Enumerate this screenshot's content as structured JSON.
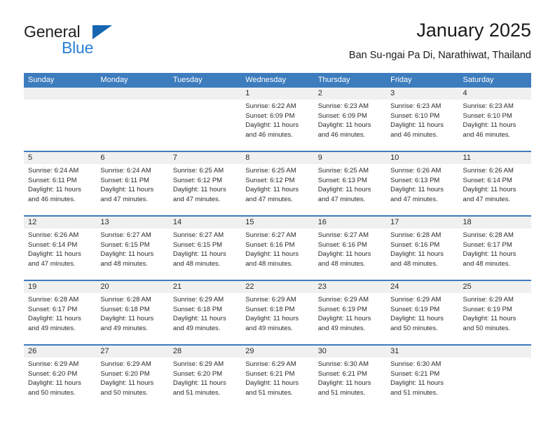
{
  "logo": {
    "word_top": "General",
    "word_bottom": "Blue",
    "triangle_icon": "triangle-icon",
    "color_text": "#231f20",
    "color_blue": "#2980d4",
    "color_triangle": "#1666b0"
  },
  "header": {
    "title": "January 2025",
    "subtitle": "Ban Su-ngai Pa Di, Narathiwat, Thailand"
  },
  "theme": {
    "header_blue": "#3d7cbd",
    "row_band_gray": "#f0f0f0",
    "text": "#2b2b2b"
  },
  "calendar": {
    "weekday_headers": [
      "Sunday",
      "Monday",
      "Tuesday",
      "Wednesday",
      "Thursday",
      "Friday",
      "Saturday"
    ],
    "weeks": [
      [
        {
          "day": "",
          "sunrise": "",
          "sunset": "",
          "daylight_line1": "",
          "daylight_line2": ""
        },
        {
          "day": "",
          "sunrise": "",
          "sunset": "",
          "daylight_line1": "",
          "daylight_line2": ""
        },
        {
          "day": "",
          "sunrise": "",
          "sunset": "",
          "daylight_line1": "",
          "daylight_line2": ""
        },
        {
          "day": "1",
          "sunrise": "Sunrise: 6:22 AM",
          "sunset": "Sunset: 6:09 PM",
          "daylight_line1": "Daylight: 11 hours",
          "daylight_line2": "and 46 minutes."
        },
        {
          "day": "2",
          "sunrise": "Sunrise: 6:23 AM",
          "sunset": "Sunset: 6:09 PM",
          "daylight_line1": "Daylight: 11 hours",
          "daylight_line2": "and 46 minutes."
        },
        {
          "day": "3",
          "sunrise": "Sunrise: 6:23 AM",
          "sunset": "Sunset: 6:10 PM",
          "daylight_line1": "Daylight: 11 hours",
          "daylight_line2": "and 46 minutes."
        },
        {
          "day": "4",
          "sunrise": "Sunrise: 6:23 AM",
          "sunset": "Sunset: 6:10 PM",
          "daylight_line1": "Daylight: 11 hours",
          "daylight_line2": "and 46 minutes."
        }
      ],
      [
        {
          "day": "5",
          "sunrise": "Sunrise: 6:24 AM",
          "sunset": "Sunset: 6:11 PM",
          "daylight_line1": "Daylight: 11 hours",
          "daylight_line2": "and 46 minutes."
        },
        {
          "day": "6",
          "sunrise": "Sunrise: 6:24 AM",
          "sunset": "Sunset: 6:11 PM",
          "daylight_line1": "Daylight: 11 hours",
          "daylight_line2": "and 47 minutes."
        },
        {
          "day": "7",
          "sunrise": "Sunrise: 6:25 AM",
          "sunset": "Sunset: 6:12 PM",
          "daylight_line1": "Daylight: 11 hours",
          "daylight_line2": "and 47 minutes."
        },
        {
          "day": "8",
          "sunrise": "Sunrise: 6:25 AM",
          "sunset": "Sunset: 6:12 PM",
          "daylight_line1": "Daylight: 11 hours",
          "daylight_line2": "and 47 minutes."
        },
        {
          "day": "9",
          "sunrise": "Sunrise: 6:25 AM",
          "sunset": "Sunset: 6:13 PM",
          "daylight_line1": "Daylight: 11 hours",
          "daylight_line2": "and 47 minutes."
        },
        {
          "day": "10",
          "sunrise": "Sunrise: 6:26 AM",
          "sunset": "Sunset: 6:13 PM",
          "daylight_line1": "Daylight: 11 hours",
          "daylight_line2": "and 47 minutes."
        },
        {
          "day": "11",
          "sunrise": "Sunrise: 6:26 AM",
          "sunset": "Sunset: 6:14 PM",
          "daylight_line1": "Daylight: 11 hours",
          "daylight_line2": "and 47 minutes."
        }
      ],
      [
        {
          "day": "12",
          "sunrise": "Sunrise: 6:26 AM",
          "sunset": "Sunset: 6:14 PM",
          "daylight_line1": "Daylight: 11 hours",
          "daylight_line2": "and 47 minutes."
        },
        {
          "day": "13",
          "sunrise": "Sunrise: 6:27 AM",
          "sunset": "Sunset: 6:15 PM",
          "daylight_line1": "Daylight: 11 hours",
          "daylight_line2": "and 48 minutes."
        },
        {
          "day": "14",
          "sunrise": "Sunrise: 6:27 AM",
          "sunset": "Sunset: 6:15 PM",
          "daylight_line1": "Daylight: 11 hours",
          "daylight_line2": "and 48 minutes."
        },
        {
          "day": "15",
          "sunrise": "Sunrise: 6:27 AM",
          "sunset": "Sunset: 6:16 PM",
          "daylight_line1": "Daylight: 11 hours",
          "daylight_line2": "and 48 minutes."
        },
        {
          "day": "16",
          "sunrise": "Sunrise: 6:27 AM",
          "sunset": "Sunset: 6:16 PM",
          "daylight_line1": "Daylight: 11 hours",
          "daylight_line2": "and 48 minutes."
        },
        {
          "day": "17",
          "sunrise": "Sunrise: 6:28 AM",
          "sunset": "Sunset: 6:16 PM",
          "daylight_line1": "Daylight: 11 hours",
          "daylight_line2": "and 48 minutes."
        },
        {
          "day": "18",
          "sunrise": "Sunrise: 6:28 AM",
          "sunset": "Sunset: 6:17 PM",
          "daylight_line1": "Daylight: 11 hours",
          "daylight_line2": "and 48 minutes."
        }
      ],
      [
        {
          "day": "19",
          "sunrise": "Sunrise: 6:28 AM",
          "sunset": "Sunset: 6:17 PM",
          "daylight_line1": "Daylight: 11 hours",
          "daylight_line2": "and 49 minutes."
        },
        {
          "day": "20",
          "sunrise": "Sunrise: 6:28 AM",
          "sunset": "Sunset: 6:18 PM",
          "daylight_line1": "Daylight: 11 hours",
          "daylight_line2": "and 49 minutes."
        },
        {
          "day": "21",
          "sunrise": "Sunrise: 6:29 AM",
          "sunset": "Sunset: 6:18 PM",
          "daylight_line1": "Daylight: 11 hours",
          "daylight_line2": "and 49 minutes."
        },
        {
          "day": "22",
          "sunrise": "Sunrise: 6:29 AM",
          "sunset": "Sunset: 6:18 PM",
          "daylight_line1": "Daylight: 11 hours",
          "daylight_line2": "and 49 minutes."
        },
        {
          "day": "23",
          "sunrise": "Sunrise: 6:29 AM",
          "sunset": "Sunset: 6:19 PM",
          "daylight_line1": "Daylight: 11 hours",
          "daylight_line2": "and 49 minutes."
        },
        {
          "day": "24",
          "sunrise": "Sunrise: 6:29 AM",
          "sunset": "Sunset: 6:19 PM",
          "daylight_line1": "Daylight: 11 hours",
          "daylight_line2": "and 50 minutes."
        },
        {
          "day": "25",
          "sunrise": "Sunrise: 6:29 AM",
          "sunset": "Sunset: 6:19 PM",
          "daylight_line1": "Daylight: 11 hours",
          "daylight_line2": "and 50 minutes."
        }
      ],
      [
        {
          "day": "26",
          "sunrise": "Sunrise: 6:29 AM",
          "sunset": "Sunset: 6:20 PM",
          "daylight_line1": "Daylight: 11 hours",
          "daylight_line2": "and 50 minutes."
        },
        {
          "day": "27",
          "sunrise": "Sunrise: 6:29 AM",
          "sunset": "Sunset: 6:20 PM",
          "daylight_line1": "Daylight: 11 hours",
          "daylight_line2": "and 50 minutes."
        },
        {
          "day": "28",
          "sunrise": "Sunrise: 6:29 AM",
          "sunset": "Sunset: 6:20 PM",
          "daylight_line1": "Daylight: 11 hours",
          "daylight_line2": "and 51 minutes."
        },
        {
          "day": "29",
          "sunrise": "Sunrise: 6:29 AM",
          "sunset": "Sunset: 6:21 PM",
          "daylight_line1": "Daylight: 11 hours",
          "daylight_line2": "and 51 minutes."
        },
        {
          "day": "30",
          "sunrise": "Sunrise: 6:30 AM",
          "sunset": "Sunset: 6:21 PM",
          "daylight_line1": "Daylight: 11 hours",
          "daylight_line2": "and 51 minutes."
        },
        {
          "day": "31",
          "sunrise": "Sunrise: 6:30 AM",
          "sunset": "Sunset: 6:21 PM",
          "daylight_line1": "Daylight: 11 hours",
          "daylight_line2": "and 51 minutes."
        },
        {
          "day": "",
          "sunrise": "",
          "sunset": "",
          "daylight_line1": "",
          "daylight_line2": ""
        }
      ]
    ]
  }
}
